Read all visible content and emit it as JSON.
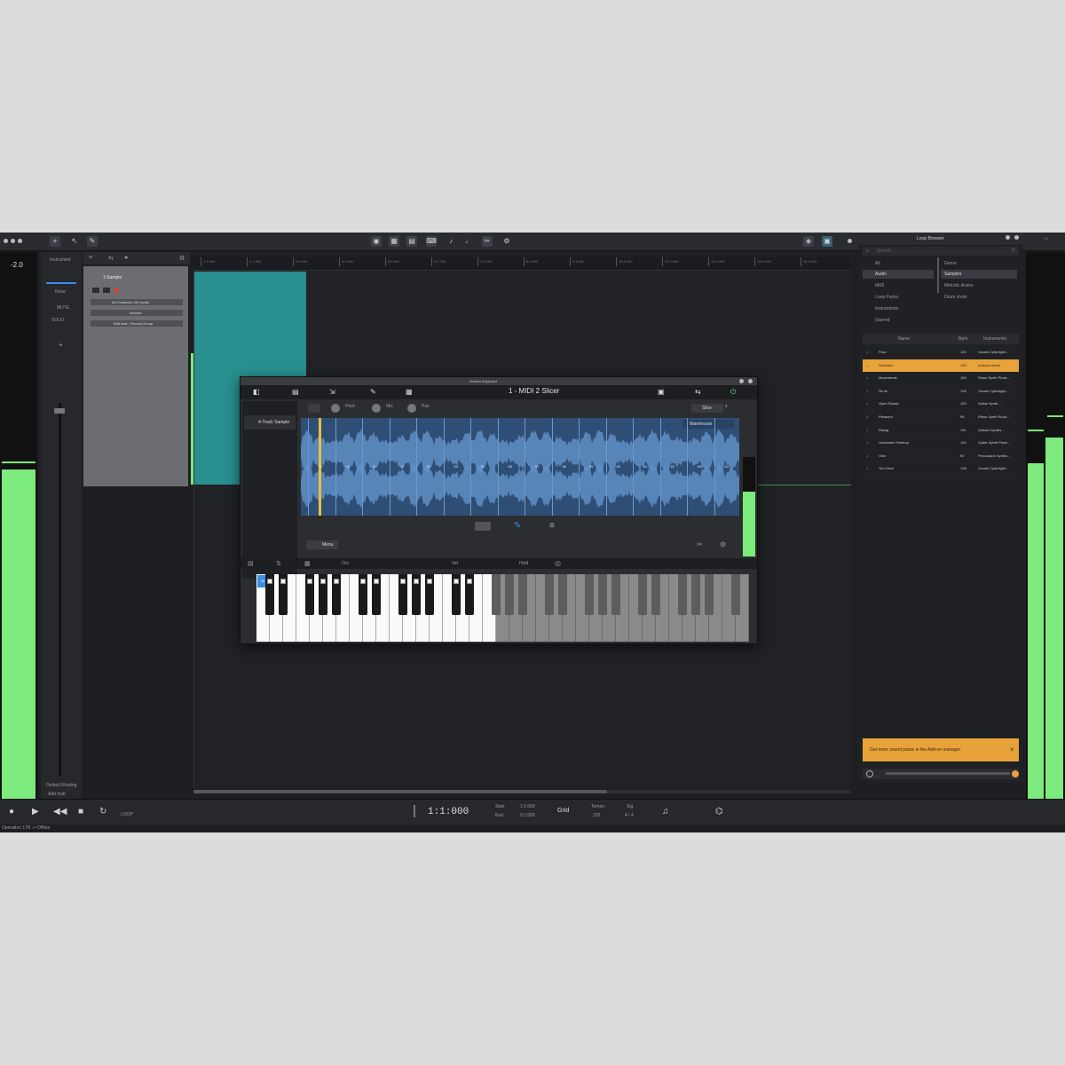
{
  "app": {
    "title": "Loop Browser",
    "status_left": "Operation 1TB -> Offline"
  },
  "inspector": {
    "db_value": "-2.0",
    "labels": [
      "Instrument",
      "None",
      "MUTE",
      "SOLO"
    ],
    "bottom_labels": [
      "Default Routing",
      "Add Instr"
    ]
  },
  "track": {
    "name": "1 Sample",
    "instrument": "1 - MIDI 2 Slicer",
    "fields": [
      "All Channels / All Inputs",
      "Internal",
      "Edit Instr / Record Group"
    ]
  },
  "ruler": {
    "marks": [
      "1:1:000",
      "2:1:000",
      "3:1:000",
      "4:1:000",
      "5:1:000",
      "6:1:000",
      "7:1:000",
      "8:1:000",
      "9:1:000",
      "10:1:000",
      "11:1:000",
      "12:1:000",
      "13:1:000",
      "14:1:000"
    ]
  },
  "plugin": {
    "window_title": "Screen Keyboard",
    "instrument_title": "1 - MIDI 2 Slicer",
    "subtitle": "4 Track Sample",
    "left_label": "4-Track Sample",
    "knobs": [
      "Pitch",
      "Mix",
      "Pan"
    ],
    "mode": "Slice",
    "waveform_label": "Warehouse",
    "slice_numbers": [
      "49",
      "50",
      "51",
      "52",
      "53",
      "54",
      "55",
      "56",
      "57",
      "58",
      "59",
      "60",
      "61",
      "62",
      "63",
      "64"
    ],
    "footer_button": "Menu",
    "keyboard_labels": [
      "Oct",
      "Vel",
      "Hold"
    ],
    "highlight_key": "49"
  },
  "browser": {
    "search_placeholder": "Search",
    "categories": [
      "All",
      "Audio",
      "MIDI",
      "Loop Packs",
      "Instruments",
      "Starred"
    ],
    "filters": [
      "Genre",
      "Samples",
      "Melodic drums",
      "Drum shots"
    ],
    "columns": [
      "Name",
      "Bpm",
      "Instruments"
    ],
    "rows": [
      {
        "name": "Flow",
        "bpm": "120",
        "inst": "Vocals Cyberlight..."
      },
      {
        "name": "Selection",
        "bpm": "130",
        "inst": "Independence",
        "selected": true
      },
      {
        "name": "Movements",
        "bpm": "105",
        "inst": "Piano Synth Pluck..."
      },
      {
        "name": "Sit ok",
        "bpm": "128",
        "inst": "Vocals Cyberlight..."
      },
      {
        "name": "Open Roads",
        "bpm": "100",
        "inst": "Guitar Synth..."
      },
      {
        "name": "Pleasure",
        "bpm": "95",
        "inst": "Piano Synth Pluck..."
      },
      {
        "name": "Rising",
        "bpm": "110",
        "inst": "Guitars Synths..."
      },
      {
        "name": "Uncharted Territory",
        "bpm": "120",
        "inst": "Cyber Synth Pluck..."
      },
      {
        "name": "Vibe",
        "bpm": "90",
        "inst": "Percussion Synths..."
      },
      {
        "name": "You Drive",
        "bpm": "128",
        "inst": "Vocals Cyberlight..."
      }
    ],
    "notice": "Get more sound packs in the Add-on manager",
    "notice_close": "×"
  },
  "transport": {
    "position": "1:1:000",
    "start_label": "Start",
    "end_label": "End",
    "start_value": "1:1:000",
    "end_value": "9:1:000",
    "grid_label": "Grid",
    "tempo_label": "Tempo",
    "tempo_value": "120",
    "sig_label": "Sig",
    "sig_value": "4 / 4",
    "loop_label": "LOOP"
  },
  "meters": {
    "left_level": 0.63,
    "right_level": 0.69,
    "plugin_level": 0.65
  },
  "colors": {
    "accent_green": "#7cea7c",
    "clip_teal": "#2a8f8f",
    "selection_orange": "#e8a23a",
    "wave_blue": "#3f6aa0",
    "key_blue": "#3a8ee6"
  }
}
